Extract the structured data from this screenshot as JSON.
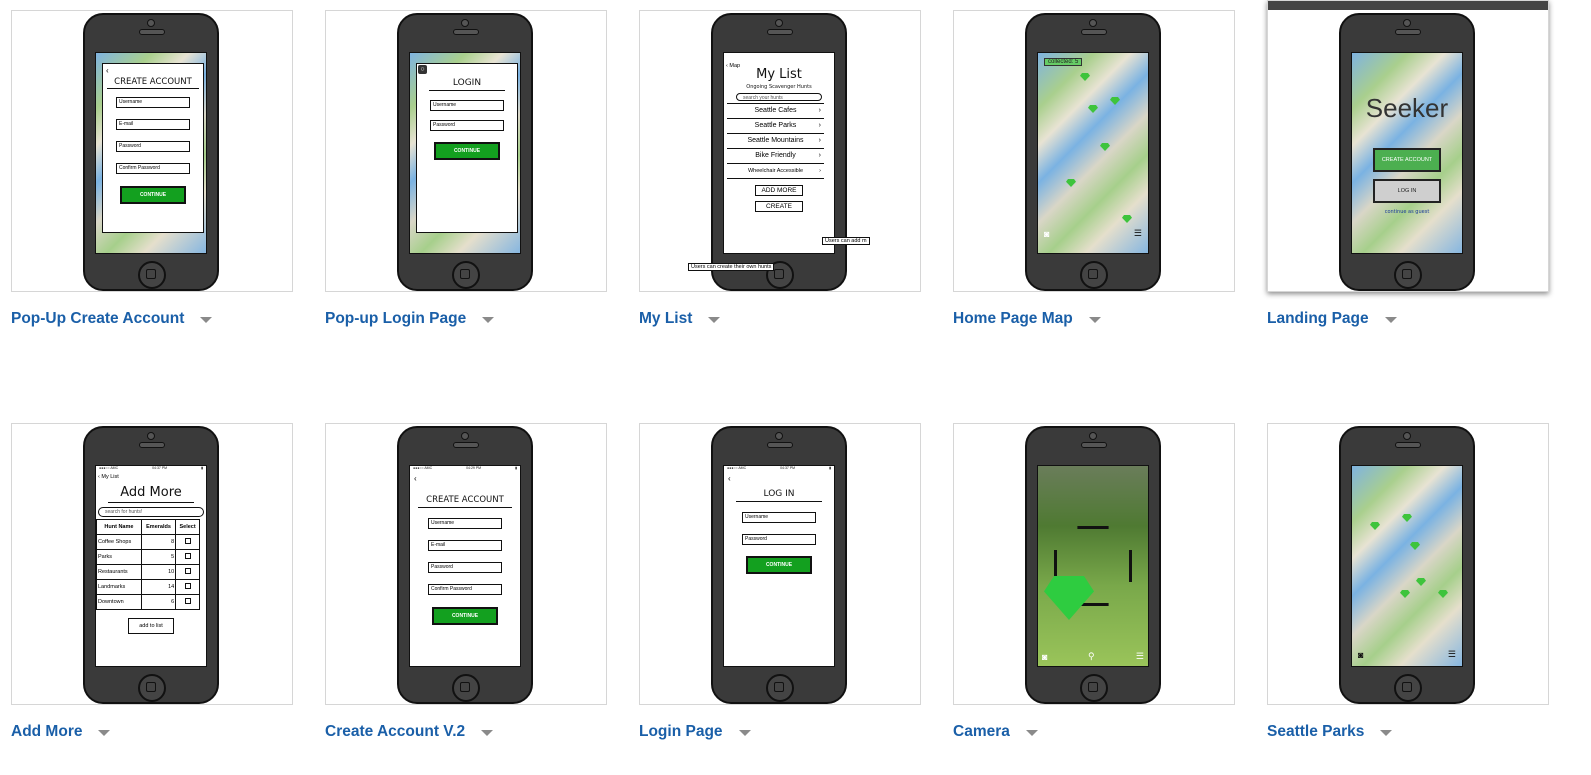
{
  "cards": [
    {
      "id": "c1",
      "label": "Pop-Up Create Account",
      "screen": {
        "title": "CREATE ACCOUNT",
        "fields": [
          "Username",
          "E-mail",
          "Password",
          "Confirm Password"
        ],
        "button": "CONTINUE"
      }
    },
    {
      "id": "c2",
      "label": "Pop-up Login Page",
      "screen": {
        "title": "LOGIN",
        "fields": [
          "Username",
          "Password"
        ],
        "button": "CONTINUE"
      }
    },
    {
      "id": "c3",
      "label": "My List",
      "screen": {
        "back": "Map",
        "title": "My List",
        "subtitle": "Ongoing Scavenger Hunts",
        "search": "search your hunts",
        "items": [
          "Seattle Cafes",
          "Seattle Parks",
          "Seattle Mountains",
          "Bike Friendly",
          "Wheelchair Accessible"
        ],
        "add_more": "ADD MORE",
        "create": "CREATE",
        "note_left": "Users can create their own hunts",
        "note_right": "Users can add m"
      }
    },
    {
      "id": "c4",
      "label": "Home Page Map",
      "screen": {
        "badge": "collected: 5"
      }
    },
    {
      "id": "c5",
      "label": "Landing Page",
      "screen": {
        "title": "Seeker",
        "create_btn": "CREATE ACCOUNT",
        "login_btn": "LOG IN",
        "guest": "continue as guest"
      }
    },
    {
      "id": "c6",
      "label": "Add More",
      "screen": {
        "status_left": "●●●○○ AMC",
        "status_time": "04:37 PM",
        "back": "My List",
        "title": "Add More",
        "search": "search for hunts!",
        "headers": [
          "Hunt Name",
          "Emeralds",
          "Select"
        ],
        "rows": [
          [
            "Coffee Shops",
            "8"
          ],
          [
            "Parks",
            "5"
          ],
          [
            "Restaurants",
            "10"
          ],
          [
            "Landmarks",
            "14"
          ],
          [
            "Downtown",
            "6"
          ]
        ],
        "button": "add to list"
      }
    },
    {
      "id": "c7",
      "label": "Create Account V.2",
      "screen": {
        "status_left": "●●●○○ AMC",
        "status_time": "04:29 PM",
        "title": "CREATE ACCOUNT",
        "fields": [
          "Username",
          "E-mail",
          "Password",
          "Confirm Password"
        ],
        "button": "CONTINUE"
      }
    },
    {
      "id": "c8",
      "label": "Login Page",
      "screen": {
        "status_left": "●●●○○ AMC",
        "status_time": "04:37 PM",
        "title": "LOG IN",
        "fields": [
          "Username",
          "Password"
        ],
        "button": "CONTINUE"
      }
    },
    {
      "id": "c9",
      "label": "Camera",
      "screen": {}
    },
    {
      "id": "c10",
      "label": "Seattle Parks",
      "screen": {}
    }
  ],
  "colors": {
    "link": "#1a5fa8",
    "green_button": "#13a01f",
    "phone_body": "#3a3a3a"
  },
  "icons": {
    "dropdown": "caret-down-icon"
  }
}
